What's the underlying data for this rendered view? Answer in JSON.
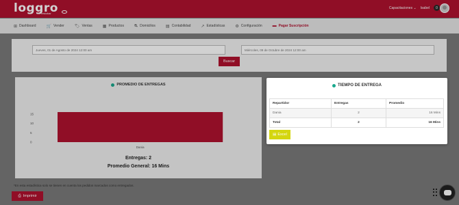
{
  "header": {
    "logo_text": "loggro",
    "logo_sub": "restobar",
    "user_menu": "Capacitaciones ⌄",
    "user_name": "Isabel",
    "bell_count": "0"
  },
  "nav": [
    {
      "icon": "⊞",
      "label": "Dashboard",
      "name": "dashboard",
      "active": false
    },
    {
      "icon": "🛒",
      "label": "Vender",
      "name": "vender",
      "active": false
    },
    {
      "icon": "🏷",
      "label": "Ventas",
      "name": "ventas",
      "active": false
    },
    {
      "icon": "▦",
      "label": "Productos",
      "name": "productos",
      "active": false
    },
    {
      "icon": "⛐",
      "label": "Domicilios",
      "name": "domicilios",
      "active": false
    },
    {
      "icon": "▤",
      "label": "Contabilidad",
      "name": "contabilidad",
      "active": false
    },
    {
      "icon": "↗",
      "label": "Estadísticas",
      "name": "estadisticas",
      "active": false
    },
    {
      "icon": "⚙",
      "label": "Configuración",
      "name": "configuracion",
      "active": false
    },
    {
      "icon": "▬",
      "label": "Pagar Suscripción",
      "name": "pagar-suscripcion",
      "active": true
    }
  ],
  "filters": {
    "start_date": "Jueves, 01 de Agosto de 2024 12:00 am",
    "end_date": "Miércoles, 09 de Octubre de 2024 12:00 am",
    "search_label": "Buscar"
  },
  "chart_card": {
    "title": "PROMEDIO DE ENTREGAS",
    "deliveries_text": "Entregas: 2",
    "avg_text": "Promedio General: 16 Mins"
  },
  "chart_data": {
    "type": "bar",
    "title": "PROMEDIO DE ENTREGAS",
    "categories": [
      "Dania"
    ],
    "values": [
      16
    ],
    "ylim": [
      0,
      20
    ],
    "yticks": [
      0,
      5,
      10,
      15,
      20
    ],
    "bar_color": "#b0122f",
    "grid": false
  },
  "footnote": "*En esta estadística solo se tienen en cuenta los pedidos marcados como entregados.",
  "print_label": "Imprimir",
  "modal": {
    "title": "TIEMPO DE ENTREGA",
    "columns": [
      "Repartidor",
      "Entregas",
      "Promedio"
    ],
    "rows": [
      {
        "repartidor": "Dania",
        "entregas": "2",
        "promedio": "16 Mins"
      }
    ],
    "total": {
      "label": "Total",
      "entregas": "2",
      "promedio": "16 Mins"
    },
    "excel_label": "Excel"
  },
  "colors": {
    "brand": "#b0122f",
    "accent_dot": "#1aa88d",
    "excel": "#d4d60f"
  }
}
